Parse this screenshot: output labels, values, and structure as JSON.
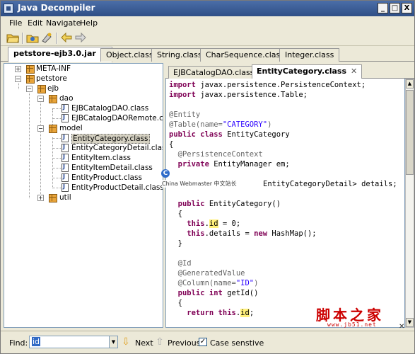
{
  "window": {
    "title": "Java Decompiler",
    "controls": [
      "_",
      "□",
      "X"
    ]
  },
  "menu": [
    "File",
    "Edit",
    "Navigate",
    "Help"
  ],
  "toolbar": {
    "icons": [
      "open-file-icon",
      "open-type-icon",
      "open-reference-icon",
      "back-icon",
      "forward-icon"
    ]
  },
  "outer_tabs": [
    {
      "label": "petstore-ejb3.0.jar",
      "active": true,
      "close": "✕"
    },
    {
      "label": "Object.class"
    },
    {
      "label": "String.class"
    },
    {
      "label": "CharSequence.class"
    },
    {
      "label": "Integer.class"
    }
  ],
  "tree": {
    "nodes": [
      {
        "label": "META-INF",
        "expander": "+"
      },
      {
        "label": "petstore",
        "expander": "−"
      },
      {
        "label": "ejb",
        "expander": "−"
      },
      {
        "label": "dao",
        "expander": "−"
      },
      {
        "label": "EJBCatalogDAO.class"
      },
      {
        "label": "EJBCatalogDAORemote.class"
      },
      {
        "label": "model",
        "expander": "−"
      },
      {
        "label": "EntityCategory.class",
        "selected": true
      },
      {
        "label": "EntityCategoryDetail.class"
      },
      {
        "label": "EntityItem.class"
      },
      {
        "label": "EntityItemDetail.class"
      },
      {
        "label": "EntityProduct.class"
      },
      {
        "label": "EntityProductDetail.class"
      },
      {
        "label": "util",
        "expander": "+"
      }
    ]
  },
  "inner_tabs": [
    {
      "label": "EJBCatalogDAO.class"
    },
    {
      "label": "EntityCategory.class",
      "active": true,
      "close": "✕"
    }
  ],
  "code": {
    "l1a": "import",
    "l1b": " javax.persistence.PersistenceContext;",
    "l2a": "import",
    "l2b": " javax.persistence.Table;",
    "l4": "@Entity",
    "l5a": "@Table(name=",
    "l5b": "\"CATEGORY\"",
    "l5c": ")",
    "l6a": "public",
    "l6b": " ",
    "l6c": "class",
    "l6d": " EntityCategory",
    "l7": "{",
    "l8": "  @PersistenceContext",
    "l9a": "  private",
    "l9b": " EntityManager em;",
    "l11": "EntityCategoryDetail> details;",
    "l13a": "  public",
    "l13b": " EntityCategory()",
    "l14": "  {",
    "l15a": "    this",
    "l15b": ".",
    "l15c": "id",
    "l15d": " = 0;",
    "l16a": "    this",
    "l16b": ".details = ",
    "l16c": "new",
    "l16d": " HashMap();",
    "l17": "  }",
    "l19": "  @Id",
    "l20": "  @GeneratedValue",
    "l21a": "  @Column(name=",
    "l21b": "\"ID\"",
    "l21c": ")",
    "l22a": "  public",
    "l22b": " ",
    "l22c": "int",
    "l22d": " getId()",
    "l23": "  {",
    "l24a": "    return",
    "l24b": " ",
    "l24c": "this",
    "l24d": ".",
    "l24e": "id",
    "l24f": ";"
  },
  "watermark": {
    "overlay": "China Webmaster 中文站长",
    "logo": "C",
    "site_cn": "脚本之家",
    "site_url": "www.jb51.net"
  },
  "findbar": {
    "label": "Find:",
    "value": "id",
    "next": "Next",
    "previous": "Previous",
    "case_sensitive": "Case senstive",
    "case_checked": true
  }
}
